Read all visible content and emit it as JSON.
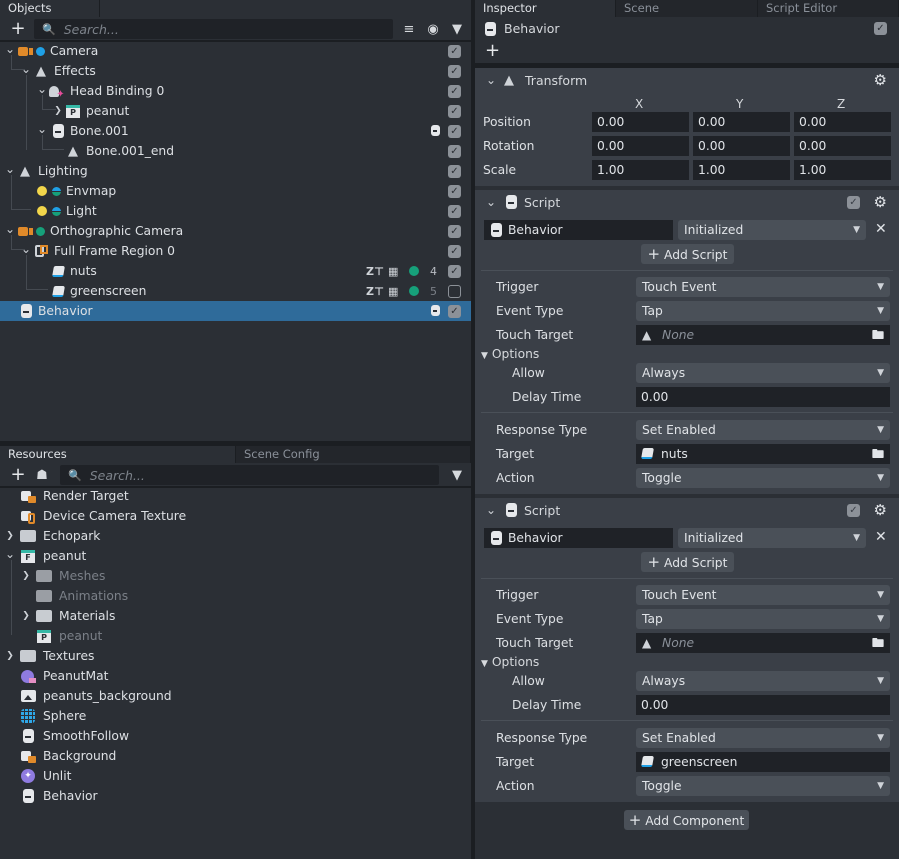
{
  "objects_panel": {
    "tab_label": "Objects",
    "search_placeholder": "Search...",
    "items": [
      {
        "label": "Camera",
        "icon": "camera-icon",
        "extra_icon": "blue-dot-icon",
        "expanded": true,
        "enabled": true
      },
      {
        "label": "Effects",
        "icon": "scene-object-icon",
        "expanded": true,
        "enabled": true
      },
      {
        "label": "Head Binding 0",
        "icon": "head-binding-icon",
        "expanded": true,
        "enabled": true
      },
      {
        "label": "peanut",
        "icon": "prefab-icon",
        "expanded": false,
        "enabled": true
      },
      {
        "label": "Bone.001",
        "icon": "script-icon",
        "expanded": true,
        "enabled": true,
        "has_script_badge": true
      },
      {
        "label": "Bone.001_end",
        "icon": "scene-object-icon",
        "enabled": true
      },
      {
        "label": "Lighting",
        "icon": "scene-object-icon",
        "expanded": true,
        "enabled": true
      },
      {
        "label": "Envmap",
        "icon": "light-bulb-icon",
        "extra_icon": "layer-icon",
        "enabled": true
      },
      {
        "label": "Light",
        "icon": "light-bulb-icon",
        "extra_icon": "layer-icon",
        "enabled": true
      },
      {
        "label": "Orthographic Camera",
        "icon": "camera-icon",
        "extra_icon": "green-dot-icon",
        "expanded": true,
        "enabled": true
      },
      {
        "label": "Full Frame Region 0",
        "icon": "screen-region-icon",
        "expanded": true,
        "enabled": true
      },
      {
        "label": "nuts",
        "icon": "screen-image-icon",
        "render_order": "4",
        "enabled": true
      },
      {
        "label": "greenscreen",
        "icon": "screen-image-icon",
        "render_order": "5",
        "enabled": false
      },
      {
        "label": "Behavior",
        "icon": "script-icon",
        "selected": true,
        "enabled": true,
        "has_script_badge": true
      }
    ]
  },
  "resources_panel": {
    "tabs": [
      "Resources",
      "Scene Config"
    ],
    "search_placeholder": "Search...",
    "items": [
      {
        "label": "Render Target",
        "icon": "render-target-icon"
      },
      {
        "label": "Device Camera Texture",
        "icon": "device-camera-texture-icon"
      },
      {
        "label": "Echopark",
        "icon": "folder-icon",
        "expandable": true
      },
      {
        "label": "peanut",
        "icon": "package-icon",
        "expanded": true
      },
      {
        "label": "Meshes",
        "icon": "folder-icon",
        "expandable": true,
        "dim": true
      },
      {
        "label": "Animations",
        "icon": "folder-icon",
        "dim": true
      },
      {
        "label": "Materials",
        "icon": "folder-icon",
        "expandable": true
      },
      {
        "label": "peanut",
        "icon": "prefab-icon",
        "dim": true
      },
      {
        "label": "Textures",
        "icon": "folder-icon",
        "expandable": true
      },
      {
        "label": "PeanutMat",
        "icon": "material-icon"
      },
      {
        "label": "peanuts_background",
        "icon": "image-icon"
      },
      {
        "label": "Sphere",
        "icon": "mesh-icon"
      },
      {
        "label": "SmoothFollow",
        "icon": "script-icon"
      },
      {
        "label": "Background",
        "icon": "render-target-icon"
      },
      {
        "label": "Unlit",
        "icon": "shader-icon"
      },
      {
        "label": "Behavior",
        "icon": "script-icon"
      }
    ]
  },
  "inspector": {
    "tabs": [
      "Inspector",
      "Scene",
      "Script Editor"
    ],
    "object_name": "Behavior",
    "object_enabled": true,
    "transform": {
      "title": "Transform",
      "axes": [
        "X",
        "Y",
        "Z"
      ],
      "rows": [
        {
          "label": "Position",
          "values": [
            "0.00",
            "0.00",
            "0.00"
          ]
        },
        {
          "label": "Rotation",
          "values": [
            "0.00",
            "0.00",
            "0.00"
          ]
        },
        {
          "label": "Scale",
          "values": [
            "1.00",
            "1.00",
            "1.00"
          ]
        }
      ]
    },
    "scripts": [
      {
        "title": "Script",
        "enabled": true,
        "script_name": "Behavior",
        "event": "Initialized",
        "add_script_label": "Add Script",
        "trigger_label": "Trigger",
        "trigger": "Touch Event",
        "event_type_label": "Event Type",
        "event_type": "Tap",
        "touch_target_label": "Touch Target",
        "touch_target": "None",
        "options_label": "Options",
        "allow_label": "Allow",
        "allow": "Always",
        "delay_label": "Delay Time",
        "delay": "0.00",
        "response_type_label": "Response Type",
        "response_type": "Set Enabled",
        "target_label": "Target",
        "target": "nuts",
        "action_label": "Action",
        "action": "Toggle"
      },
      {
        "title": "Script",
        "enabled": true,
        "script_name": "Behavior",
        "event": "Initialized",
        "add_script_label": "Add Script",
        "trigger_label": "Trigger",
        "trigger": "Touch Event",
        "event_type_label": "Event Type",
        "event_type": "Tap",
        "touch_target_label": "Touch Target",
        "touch_target": "None",
        "options_label": "Options",
        "allow_label": "Allow",
        "allow": "Always",
        "delay_label": "Delay Time",
        "delay": "0.00",
        "response_type_label": "Response Type",
        "response_type": "Set Enabled",
        "target_label": "Target",
        "target": "greenscreen",
        "action_label": "Action",
        "action": "Toggle"
      }
    ],
    "add_component_label": "Add Component"
  }
}
